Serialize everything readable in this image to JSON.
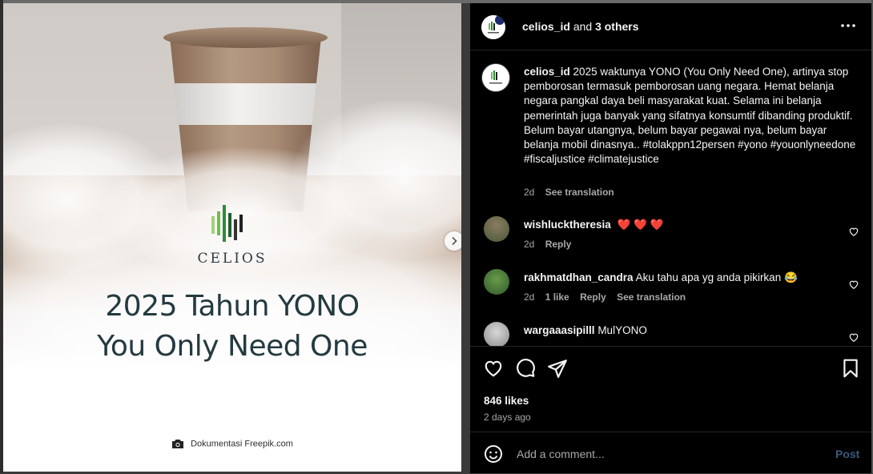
{
  "post_image": {
    "brand_name": "CELIOS",
    "headline_line1": "2025 Tahun YONO",
    "headline_line2": "You Only Need One",
    "credit": "Dokumentasi Freepik.com"
  },
  "header": {
    "username": "celios_id",
    "connector": "and",
    "others": "3 others"
  },
  "caption": {
    "username": "celios_id",
    "text": "2025 waktunya YONO (You Only Need One), artinya stop pemborosan termasuk pemborosan uang negara. Hemat belanja negara pangkal daya beli masyarakat kuat. Selama ini belanja pemerintah juga banyak yang sifatnya konsumtif dibanding produktif. Belum bayar utangnya, belum bayar pegawai nya, belum bayar belanja mobil dinasnya.. #tolakppn12persen #yono #youonlyneedone #fiscaljustice #climatejustice",
    "time": "2d",
    "translate": "See translation"
  },
  "comments": [
    {
      "username": "wishlucktheresia",
      "text": "❤️ ❤️ ❤️",
      "time": "2d",
      "likes": "",
      "reply": "Reply",
      "translate": ""
    },
    {
      "username": "rakhmatdhan_candra",
      "text": "Aku tahu apa yg anda pikirkan 😂",
      "time": "2d",
      "likes": "1 like",
      "reply": "Reply",
      "translate": "See translation"
    },
    {
      "username": "wargaaasipilll",
      "text": "MulYONO",
      "time": "",
      "likes": "",
      "reply": "",
      "translate": ""
    }
  ],
  "stats": {
    "likes": "846 likes",
    "posted": "2 days ago"
  },
  "composer": {
    "placeholder": "Add a comment...",
    "post_label": "Post"
  },
  "colors": {
    "panel_bg": "#000000",
    "text_primary": "#f5f5f5",
    "text_secondary": "#a8a8a8",
    "post_disabled": "#3a5a7a",
    "heart_red": "#ff3040",
    "headline": "#233a40"
  },
  "icons": [
    "chevron-right-icon",
    "more-icon",
    "heart-icon",
    "comment-icon",
    "share-icon",
    "bookmark-icon",
    "emoji-icon",
    "camera-icon"
  ]
}
